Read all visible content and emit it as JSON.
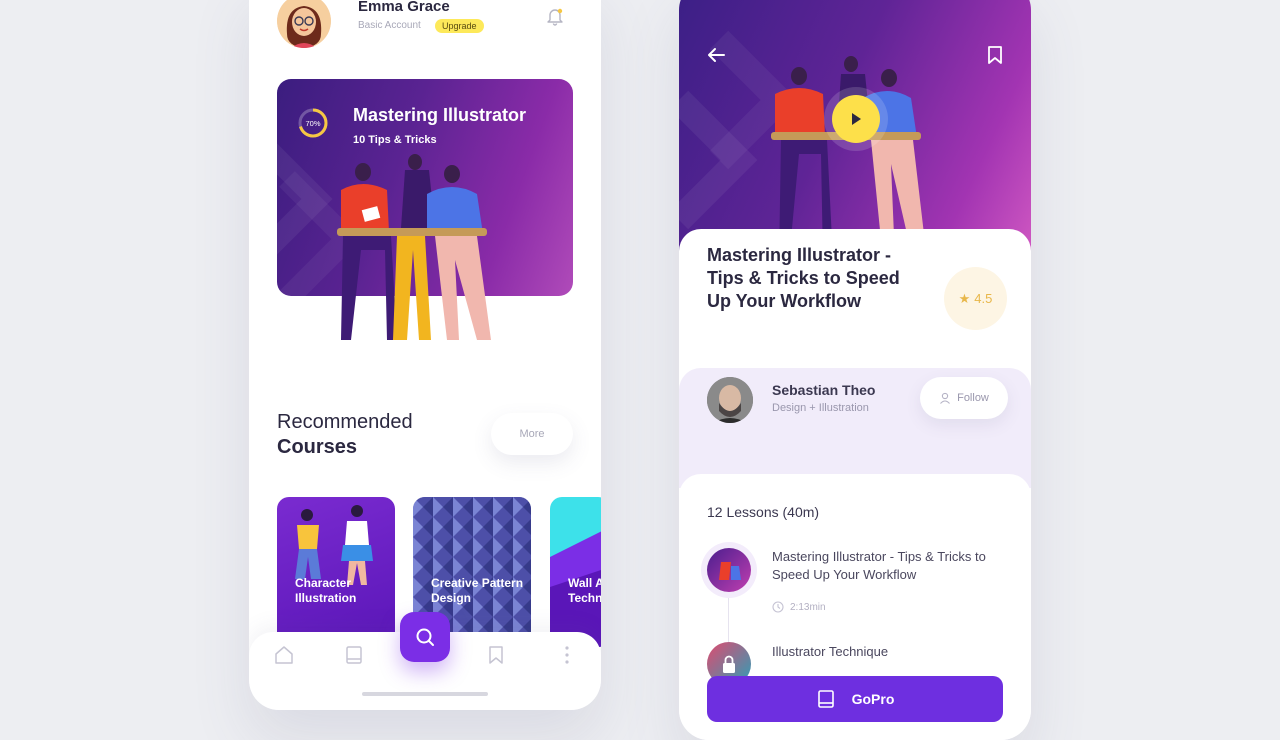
{
  "profile": {
    "name": "Emma Grace",
    "account_type": "Basic Account",
    "upgrade_label": "Upgrade"
  },
  "featured_course": {
    "title": "Mastering Illustrator",
    "subtitle": "10 Tips & Tricks",
    "progress_label": "70%",
    "progress": 0.7
  },
  "recommended": {
    "title_line1": "Recommended",
    "title_line2": "Courses",
    "more_label": "More",
    "courses": [
      {
        "label": "Character Illustration"
      },
      {
        "label": "Creative Pattern Design"
      },
      {
        "label": "Wall Art Technique"
      }
    ]
  },
  "bottom_nav": {
    "items": [
      "home",
      "book",
      "search",
      "bookmark",
      "more"
    ]
  },
  "course_detail": {
    "title": "Mastering Illustrator - Tips & Tricks to Speed Up Your Workflow",
    "rating": "4.5",
    "author": {
      "name": "Sebastian Theo",
      "role": "Design + Illustration",
      "follow_label": "Follow"
    },
    "lessons_count": "12 Lessons (40m)",
    "lessons": [
      {
        "title": "Mastering Illustrator - Tips & Tricks to Speed Up Your Workflow",
        "duration": "2:13min"
      },
      {
        "title": "Illustrator Technique"
      }
    ],
    "cta_label": "GoPro"
  },
  "colors": {
    "accent": "#7b2ee6",
    "badge_yellow": "#fde95a",
    "rating_star": "#e8b74a",
    "play_button": "#fde04a"
  }
}
